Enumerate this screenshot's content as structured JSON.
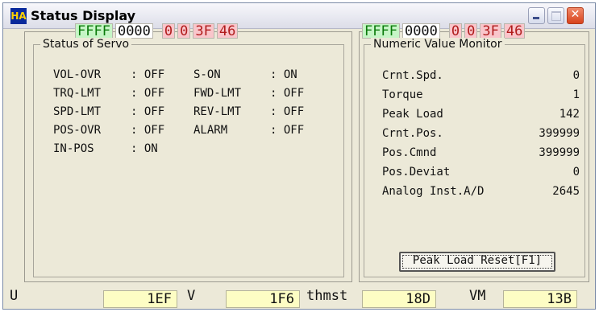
{
  "window": {
    "title": "Status Display",
    "icon_text": "HA"
  },
  "left_hex": [
    {
      "text": "FFFF",
      "style": "g"
    },
    {
      "text": "0000",
      "style": "w"
    },
    {
      "text": "0",
      "style": "p"
    },
    {
      "text": "0",
      "style": "p"
    },
    {
      "text": "3F",
      "style": "p"
    },
    {
      "text": "46",
      "style": "p"
    }
  ],
  "right_hex": [
    {
      "text": "FFFF",
      "style": "g"
    },
    {
      "text": "0000",
      "style": "w"
    },
    {
      "text": "0",
      "style": "p"
    },
    {
      "text": "0",
      "style": "p"
    },
    {
      "text": "3F",
      "style": "p"
    },
    {
      "text": "46",
      "style": "p"
    }
  ],
  "servo": {
    "title": "Status of Servo",
    "rows": [
      {
        "n1": "VOL-OVR",
        "v1": ": OFF",
        "n2": "S-ON",
        "v2": ": ON"
      },
      {
        "n1": "TRQ-LMT",
        "v1": ": OFF",
        "n2": "FWD-LMT",
        "v2": ": OFF"
      },
      {
        "n1": "SPD-LMT",
        "v1": ": OFF",
        "n2": "REV-LMT",
        "v2": ": OFF"
      },
      {
        "n1": "POS-OVR",
        "v1": ": OFF",
        "n2": "ALARM",
        "v2": ": OFF"
      },
      {
        "n1": "IN-POS",
        "v1": ": ON",
        "n2": "",
        "v2": ""
      }
    ]
  },
  "monitor": {
    "title": "Numeric Value Monitor",
    "rows": [
      {
        "label": "Crnt.Spd.",
        "value": "0"
      },
      {
        "label": "Torque",
        "value": "1"
      },
      {
        "label": "Peak Load",
        "value": "142"
      },
      {
        "label": "Crnt.Pos.",
        "value": "399999"
      },
      {
        "label": "Pos.Cmnd",
        "value": "399999"
      },
      {
        "label": "Pos.Deviat",
        "value": "0"
      },
      {
        "label": "Analog Inst.A/D",
        "value": "2645"
      }
    ],
    "reset_label": "Peak Load Reset[F1]"
  },
  "bottom": {
    "u_label": "U",
    "u_value": "1EF",
    "v_label": "V",
    "v_value": "1F6",
    "thmst_label": "thmst",
    "thmst_value": "18D",
    "vm_label": "VM",
    "vm_value": "13B"
  }
}
